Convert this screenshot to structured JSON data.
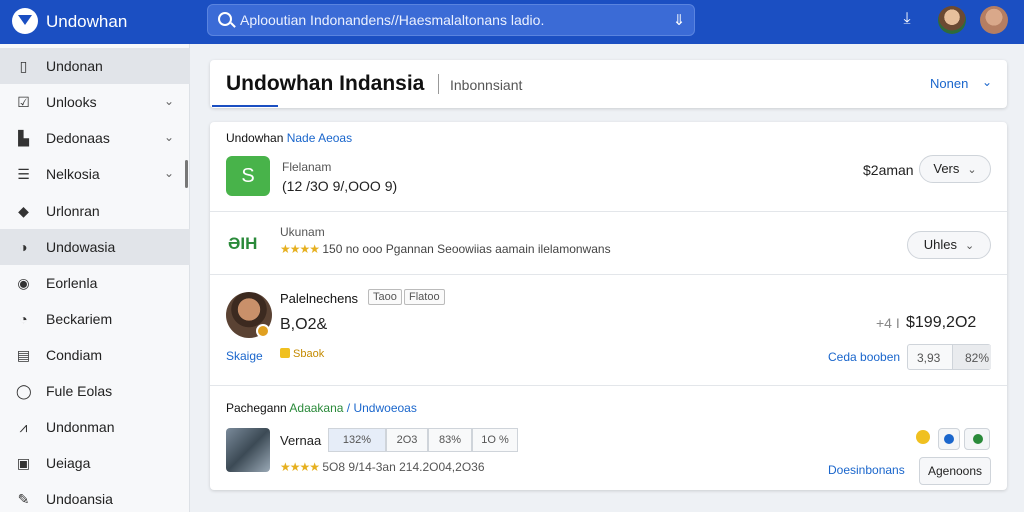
{
  "app": {
    "title": "Undowhan"
  },
  "search": {
    "placeholder": "Aplooutian Indonandens//Haesmalaltonans ladio."
  },
  "sidebar": {
    "items": [
      {
        "label": "Undonan",
        "icon": "page-icon",
        "glyph": "▯",
        "chevron": false,
        "active": true
      },
      {
        "label": "Unlooks",
        "icon": "checkbox-icon",
        "glyph": "☑",
        "chevron": true,
        "active": false
      },
      {
        "label": "Dedonaas",
        "icon": "building-icon",
        "glyph": "▙",
        "chevron": true,
        "active": false
      },
      {
        "label": "Nelkosia",
        "icon": "menu-icon",
        "glyph": "☰",
        "chevron": true,
        "active": false
      },
      {
        "label": "Urlonran",
        "icon": "tag-icon",
        "glyph": "◆",
        "chevron": false,
        "active": false
      },
      {
        "label": "Undowasia",
        "icon": "chart-icon",
        "glyph": "◑",
        "chevron": false,
        "active": true
      },
      {
        "label": "Eorlenla",
        "icon": "circle-icon",
        "glyph": "◉",
        "chevron": false,
        "active": false
      },
      {
        "label": "Beckariem",
        "icon": "history-icon",
        "glyph": "◔",
        "chevron": false,
        "active": false
      },
      {
        "label": "Condiam",
        "icon": "document-icon",
        "glyph": "▤",
        "chevron": false,
        "active": false
      },
      {
        "label": "Fule Eolas",
        "icon": "location-icon",
        "glyph": "◯",
        "chevron": false,
        "active": false
      },
      {
        "label": "Undonman",
        "icon": "activity-icon",
        "glyph": "⩘",
        "chevron": false,
        "active": false
      },
      {
        "label": "Ueiaga",
        "icon": "calendar-icon",
        "glyph": "▣",
        "chevron": false,
        "active": false
      },
      {
        "label": "Undoansia",
        "icon": "pen-icon",
        "glyph": "✎",
        "chevron": false,
        "active": false
      }
    ]
  },
  "header": {
    "title": "Undowhan Indansia",
    "subtitle": "Inbonnsiant",
    "more_label": "Nonen"
  },
  "section1": {
    "title": "Undowhan",
    "title_accent": "Nade Aeoas"
  },
  "row1": {
    "icon_letter": "S",
    "label": "Flelanam",
    "value": "(12 /3O 9/,OOO 9)",
    "price": "$2aman",
    "button": "Vers"
  },
  "row2": {
    "icon_text": "ƏIH",
    "label": "Ukunam",
    "stars": "★★★★",
    "value": "150 no ooo Pgannan Seoowiias aamain ilelamonwans",
    "button": "Uhles"
  },
  "row3": {
    "name": "Palelnechens",
    "tag1": "Taoo",
    "tag2": "Flatoo",
    "value": "B,O2&",
    "price_prefix": "+4 I",
    "price": "$199,2O2",
    "link1": "Skaige",
    "badge": "Sbaok",
    "link2": "Ceda booben",
    "pair_left": "3,93",
    "pair_right": "82%"
  },
  "section2": {
    "title": "Pachegann",
    "title_green": "Adaakana",
    "title_blue": "/ Undwoeoas"
  },
  "row4": {
    "name": "Vernaa",
    "segments": [
      "132%",
      "2O3",
      "83%",
      "1O %"
    ],
    "stars": "★★★★",
    "meta": "5O8 9/14-3an 214.2O04,2O36",
    "link": "Doesinbonans",
    "button": "Agenoons"
  }
}
